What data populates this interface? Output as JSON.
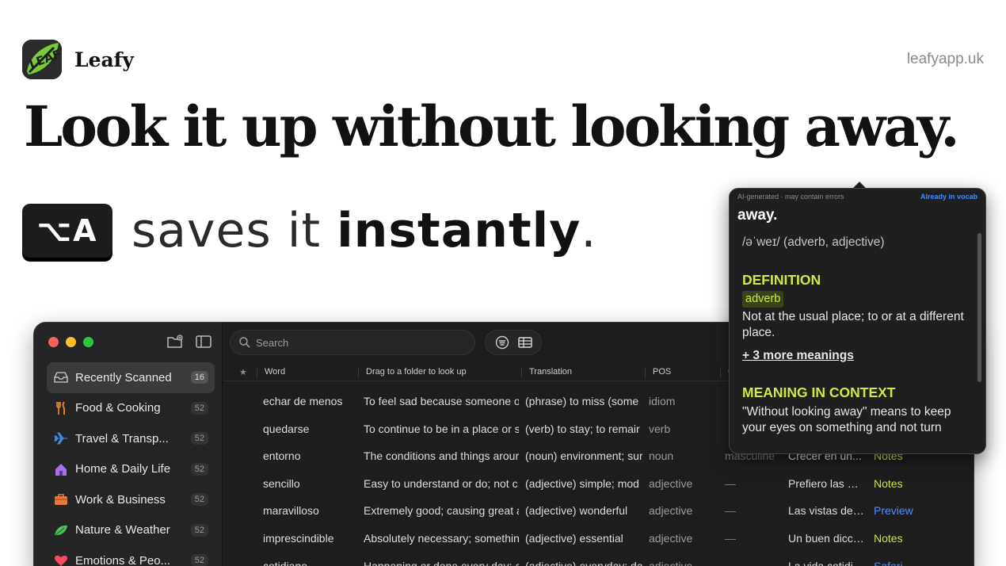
{
  "brand": {
    "name": "Leafy",
    "logo_text": "LEAFY",
    "url": "leafyapp.uk"
  },
  "hero": {
    "headline": "Look it up without looking away.",
    "shortcut_key": "⌥A",
    "tagline_pre": "saves it ",
    "tagline_bold": "instantly",
    "tagline_post": "."
  },
  "app": {
    "sidebar": {
      "items": [
        {
          "label": "Recently Scanned",
          "count": "16",
          "icon": "tray-icon",
          "active": true
        },
        {
          "label": "Food & Cooking",
          "count": "52",
          "icon": "fork-knife-icon"
        },
        {
          "label": "Travel & Transp...",
          "count": "52",
          "icon": "airplane-icon"
        },
        {
          "label": "Home & Daily Life",
          "count": "52",
          "icon": "house-icon"
        },
        {
          "label": "Work & Business",
          "count": "52",
          "icon": "briefcase-icon"
        },
        {
          "label": "Nature & Weather",
          "count": "52",
          "icon": "leaf-icon"
        },
        {
          "label": "Emotions & Peo...",
          "count": "52",
          "icon": "heart-icon"
        }
      ]
    },
    "search": {
      "placeholder": "Search"
    },
    "table": {
      "headers": {
        "star": "★",
        "word": "Word",
        "definition": "Drag to a folder to look up",
        "translation": "Translation",
        "pos": "POS",
        "gender": "G"
      },
      "rows": [
        {
          "word": "echar de menos",
          "definition": "To feel sad because someone o",
          "translation": "(phrase) to miss (some",
          "pos": "idiom",
          "gender": "",
          "example": "",
          "folder": ""
        },
        {
          "word": "quedarse",
          "definition": "To continue to be in a place or s",
          "translation": "(verb) to stay; to remair",
          "pos": "verb",
          "gender": "",
          "example": "",
          "folder": ""
        },
        {
          "word": "entorno",
          "definition": "The conditions and things arour",
          "translation": "(noun) environment; sur",
          "pos": "noun",
          "gender": "masculine",
          "example": "Crecer en un...",
          "folder": "Notes"
        },
        {
          "word": "sencillo",
          "definition": "Easy to understand or do; not c",
          "translation": "(adjective) simple; mod",
          "pos": "adjective",
          "gender": "—",
          "example": "Prefiero las ex...",
          "folder": "Notes"
        },
        {
          "word": "maravilloso",
          "definition": "Extremely good; causing great a",
          "translation": "(adjective) wonderful",
          "pos": "adjective",
          "gender": "—",
          "example": "Las vistas des...",
          "folder": "Preview"
        },
        {
          "word": "imprescindible",
          "definition": "Absolutely necessary; somethin",
          "translation": "(adjective) essential",
          "pos": "adjective",
          "gender": "—",
          "example": "Un buen dicci...",
          "folder": "Notes"
        },
        {
          "word": "cotidiano",
          "definition": "Happening or done every day; c",
          "translation": "(adjective) everyday; da",
          "pos": "adjective",
          "gender": "—",
          "example": "La vida cotidi...",
          "folder": "Safari"
        }
      ]
    }
  },
  "popup": {
    "meta": "AI-generated · may contain errors",
    "vocab_status": "Already in vocab",
    "word": "away.",
    "ipa": "/əˈweɪ/ (adverb, adjective)",
    "definition_heading": "DEFINITION",
    "pos_tag": "adverb",
    "definition": "Not at the usual place; to or at a different place.",
    "more": "+ 3 more meanings",
    "context_heading": "MEANING IN CONTEXT",
    "context": "\"Without looking away\" means to keep your eyes on something and not turn"
  },
  "colors": {
    "accent_green": "#cdeb3f",
    "link_blue": "#3e8cff",
    "folder_notes": "#c9e34a",
    "folder_preview": "#4a8cff",
    "window_bg": "#1e1e1e"
  }
}
